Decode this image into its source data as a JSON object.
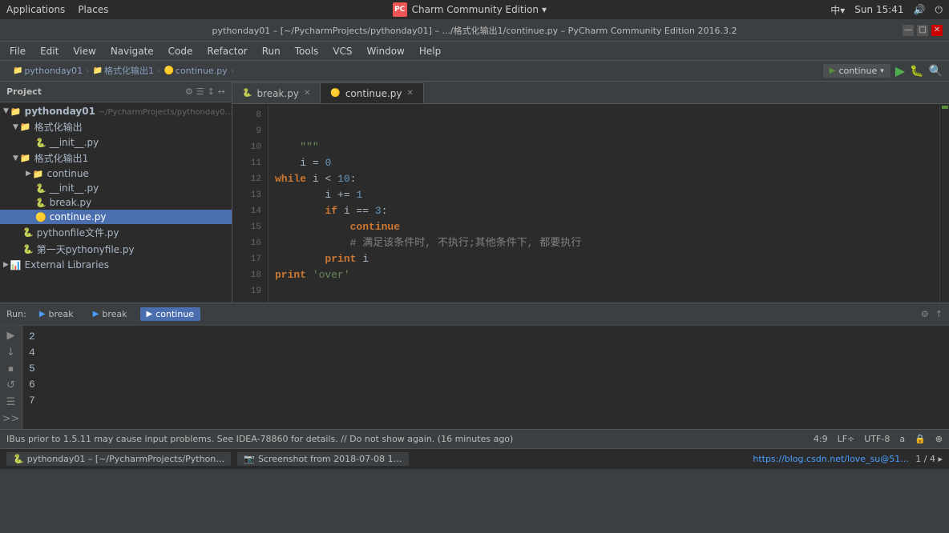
{
  "system_bar": {
    "left": {
      "applications": "Applications",
      "places": "Places"
    },
    "center": {
      "logo_text": "PC",
      "title": "Charm Community Edition",
      "dropdown": "▾"
    },
    "right": {
      "signal": "中▾",
      "time": "Sun 15:41",
      "volume": "🔊",
      "power": "⏻"
    }
  },
  "title_bar": {
    "title": "pythonday01 – [~/PycharmProjects/pythonday01] – .../格式化输出1/continue.py – PyCharm Community Edition 2016.3.2",
    "minimize": "—",
    "maximize": "□",
    "close": "✕"
  },
  "menu_bar": {
    "items": [
      "File",
      "Edit",
      "View",
      "Navigate",
      "Code",
      "Refactor",
      "Run",
      "Tools",
      "VCS",
      "Window",
      "Help"
    ]
  },
  "breadcrumb": {
    "items": [
      "pythonday01",
      "格式化输出1",
      "continue.py"
    ]
  },
  "project_panel": {
    "header": "Project",
    "icons": [
      "⚙",
      "☰",
      "↕",
      "↔"
    ],
    "tree": [
      {
        "level": 0,
        "type": "folder-open",
        "name": "pythonday01",
        "suffix": "~/PycharmProjects/pythonday0…",
        "icon": "▼"
      },
      {
        "level": 1,
        "type": "folder-open",
        "name": "格式化输出",
        "icon": "▼"
      },
      {
        "level": 2,
        "type": "file-py",
        "name": "__init__.py",
        "icon": ""
      },
      {
        "level": 1,
        "type": "folder-open",
        "name": "格式化输出1",
        "icon": "▼"
      },
      {
        "level": 2,
        "type": "folder-closed",
        "name": "continue",
        "icon": "▶"
      },
      {
        "level": 2,
        "type": "file-py",
        "name": "__init__.py",
        "icon": ""
      },
      {
        "level": 2,
        "type": "file-py",
        "name": "break.py",
        "icon": ""
      },
      {
        "level": 2,
        "type": "file-py-active",
        "name": "continue.py",
        "icon": "",
        "selected": true
      },
      {
        "level": 1,
        "type": "file-py2",
        "name": "pythonfile文件.py",
        "icon": ""
      },
      {
        "level": 1,
        "type": "file-py2",
        "name": "第一天pythonyfile.py",
        "icon": ""
      },
      {
        "level": 0,
        "type": "ext-lib",
        "name": "External Libraries",
        "icon": "▶"
      }
    ]
  },
  "editor": {
    "tabs": [
      {
        "name": "break.py",
        "active": false,
        "icon": "🔵"
      },
      {
        "name": "continue.py",
        "active": true,
        "icon": "🟡"
      }
    ],
    "lines": [
      {
        "num": 8,
        "content": ""
      },
      {
        "num": 9,
        "content": ""
      },
      {
        "num": 10,
        "content": "    \"\"\"",
        "type": "str",
        "has_arrow": true
      },
      {
        "num": 11,
        "content": "    i = 0",
        "type": "mixed"
      },
      {
        "num": 12,
        "content": "while i < 10:",
        "type": "kw"
      },
      {
        "num": 13,
        "content": "        i += 1",
        "type": "mixed"
      },
      {
        "num": 14,
        "content": "        if i == 3:",
        "type": "kw",
        "has_arrow": true
      },
      {
        "num": 15,
        "content": "            continue",
        "type": "kw"
      },
      {
        "num": 16,
        "content": "            # 满足该条件时, 不执行;其他条件下, 都要执行",
        "type": "comment",
        "has_dot": true
      },
      {
        "num": 17,
        "content": "        print i",
        "type": "mixed",
        "has_arrow": true
      },
      {
        "num": 18,
        "content": "print 'over'",
        "type": "mixed"
      },
      {
        "num": 19,
        "content": ""
      }
    ]
  },
  "toolbar": {
    "run_config": "continue",
    "run_label": "▶",
    "debug_label": "🐛",
    "search_label": "🔍"
  },
  "run_bar": {
    "label": "Run:",
    "tabs": [
      {
        "name": "break",
        "icon": "▶",
        "active": false
      },
      {
        "name": "break",
        "icon": "▶",
        "active": false
      },
      {
        "name": "continue",
        "icon": "▶",
        "active": true
      }
    ],
    "right_icons": [
      "⚙",
      "↑"
    ]
  },
  "output": {
    "lines": [
      "2",
      "4",
      "5",
      "6",
      "7"
    ]
  },
  "status_bar": {
    "message": "IBus prior to 1.5.11 may cause input problems. See IDEA-78860 for details. // Do not show again. (16 minutes ago)",
    "position": "4:9",
    "lf": "LF÷",
    "encoding": "UTF-8",
    "icons": [
      "a",
      "🔒",
      "⊕"
    ]
  },
  "taskbar": {
    "left": [
      {
        "name": "pythonday01 – [~/PycharmProjects/Python…",
        "icon": "🐍"
      },
      {
        "name": "Screenshot from 2018-07-08 1…",
        "icon": "📷"
      }
    ],
    "right": {
      "url": "https://blog.csdn.net/love_su@51…",
      "pagination": "1/4 ▸"
    }
  }
}
